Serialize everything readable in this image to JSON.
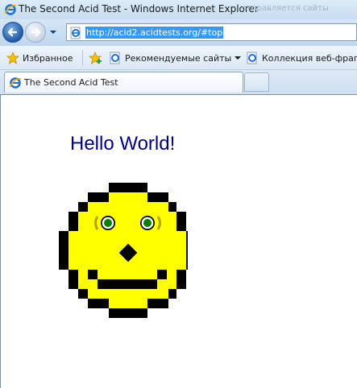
{
  "window": {
    "title": "The Second Acid Test - Windows Internet Explorer",
    "faint_text": "отправляется сайты"
  },
  "address_bar": {
    "url": "http://acid2.acidtests.org/#top"
  },
  "favorites_bar": {
    "favorites_label": "Избранное",
    "suggested_sites_label": "Рекомендуемые сайты",
    "web_slice_gallery_label": "Коллекция веб-фрагм"
  },
  "tabs": [
    {
      "label": "The Second Acid Test",
      "active": true
    }
  ],
  "page": {
    "heading": "Hello World!",
    "heading_color": "#000080",
    "face_fill": "#ffff00",
    "face_outline": "#000000",
    "eye_iris": "#008000"
  },
  "icons": {
    "window_logo": "ie-logo-icon",
    "back": "back-arrow-icon",
    "forward": "forward-arrow-icon",
    "history": "chevron-down-icon",
    "page": "ie-page-icon",
    "favorites": "star-icon",
    "add_favorite": "star-plus-icon",
    "new_tab": "new-tab-icon"
  }
}
